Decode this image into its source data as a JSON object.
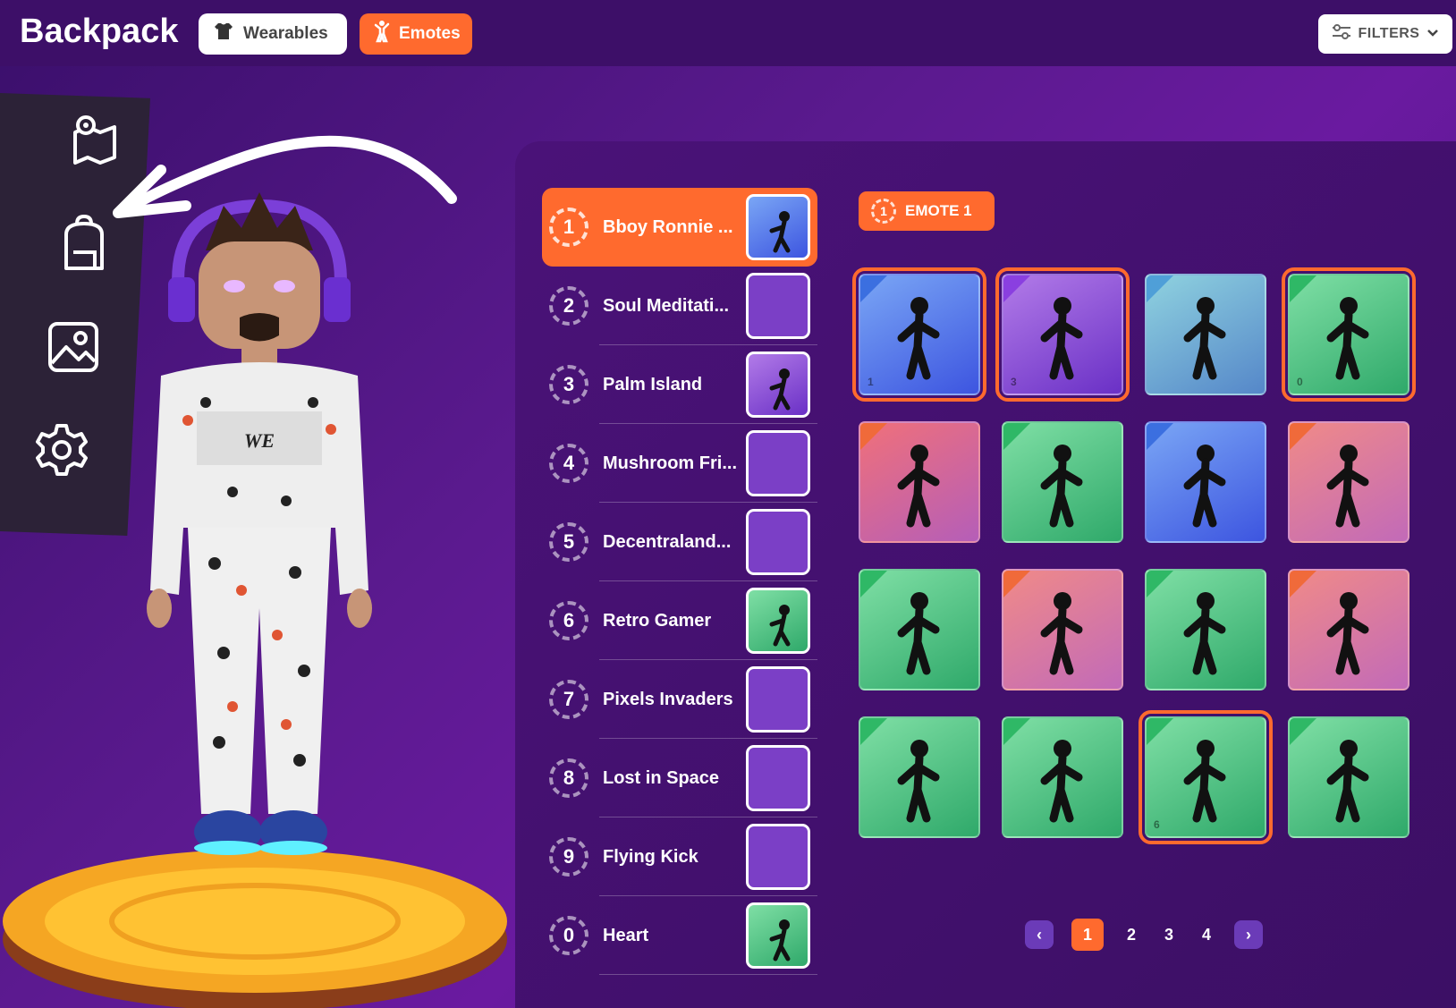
{
  "header": {
    "title": "Backpack",
    "tabs": [
      {
        "label": "Wearables",
        "icon": "shirt-icon",
        "active": false
      },
      {
        "label": "Emotes",
        "icon": "emote-figure-icon",
        "active": true
      }
    ],
    "filters_label": "FILTERS"
  },
  "sidebar": {
    "items": [
      {
        "icon": "map-icon"
      },
      {
        "icon": "backpack-icon"
      },
      {
        "icon": "gallery-icon"
      },
      {
        "icon": "settings-icon"
      }
    ]
  },
  "slots": [
    {
      "num": "1",
      "name": "Bboy Ronnie ...",
      "active": true,
      "thumb": "blue"
    },
    {
      "num": "2",
      "name": "Soul Meditati...",
      "thumb": "empty"
    },
    {
      "num": "3",
      "name": "Palm Island",
      "thumb": "purple"
    },
    {
      "num": "4",
      "name": "Mushroom Fri...",
      "thumb": "empty"
    },
    {
      "num": "5",
      "name": "Decentraland...",
      "thumb": "empty"
    },
    {
      "num": "6",
      "name": "Retro Gamer",
      "thumb": "green"
    },
    {
      "num": "7",
      "name": "Pixels Invaders",
      "thumb": "empty"
    },
    {
      "num": "8",
      "name": "Lost in Space",
      "thumb": "empty"
    },
    {
      "num": "9",
      "name": "Flying Kick",
      "thumb": "empty"
    },
    {
      "num": "0",
      "name": "Heart",
      "thumb": "green"
    }
  ],
  "selected_slot": {
    "num": "1",
    "label": "EMOTE 1"
  },
  "emote_grid": [
    {
      "bg": "blue",
      "corner": "#3b6fe0",
      "num": "1",
      "selected": true
    },
    {
      "bg": "purple",
      "corner": "#8a3fe0",
      "num": "3",
      "selected": true
    },
    {
      "bg": "teal",
      "corner": "#4f9fd8",
      "num": "",
      "selected": false
    },
    {
      "bg": "green",
      "corner": "#2fb866",
      "num": "0",
      "selected": true
    },
    {
      "bg": "red",
      "corner": "#f06a3a",
      "num": "",
      "selected": false
    },
    {
      "bg": "green",
      "corner": "#2fb866",
      "num": "",
      "selected": false
    },
    {
      "bg": "blue",
      "corner": "#3b6fe0",
      "num": "",
      "selected": false
    },
    {
      "bg": "pink",
      "corner": "#f06a3a",
      "num": "",
      "selected": false
    },
    {
      "bg": "green",
      "corner": "#2fb866",
      "num": "",
      "selected": false
    },
    {
      "bg": "pink",
      "corner": "#f06a3a",
      "num": "",
      "selected": false
    },
    {
      "bg": "green",
      "corner": "#2fb866",
      "num": "",
      "selected": false
    },
    {
      "bg": "pink",
      "corner": "#f06a3a",
      "num": "",
      "selected": false
    },
    {
      "bg": "green",
      "corner": "#2fb866",
      "num": "",
      "selected": false
    },
    {
      "bg": "green",
      "corner": "#2fb866",
      "num": "",
      "selected": false
    },
    {
      "bg": "green",
      "corner": "#2fb866",
      "num": "6",
      "selected": true
    },
    {
      "bg": "green",
      "corner": "#2fb866",
      "num": "",
      "selected": false
    }
  ],
  "pagination": {
    "pages": [
      "1",
      "2",
      "3",
      "4"
    ],
    "current": "1",
    "prev": "‹",
    "next": "›"
  },
  "colors": {
    "accent": "#ff6a2e",
    "panel": "#3c0f65",
    "topbar": "#3d0f68"
  }
}
